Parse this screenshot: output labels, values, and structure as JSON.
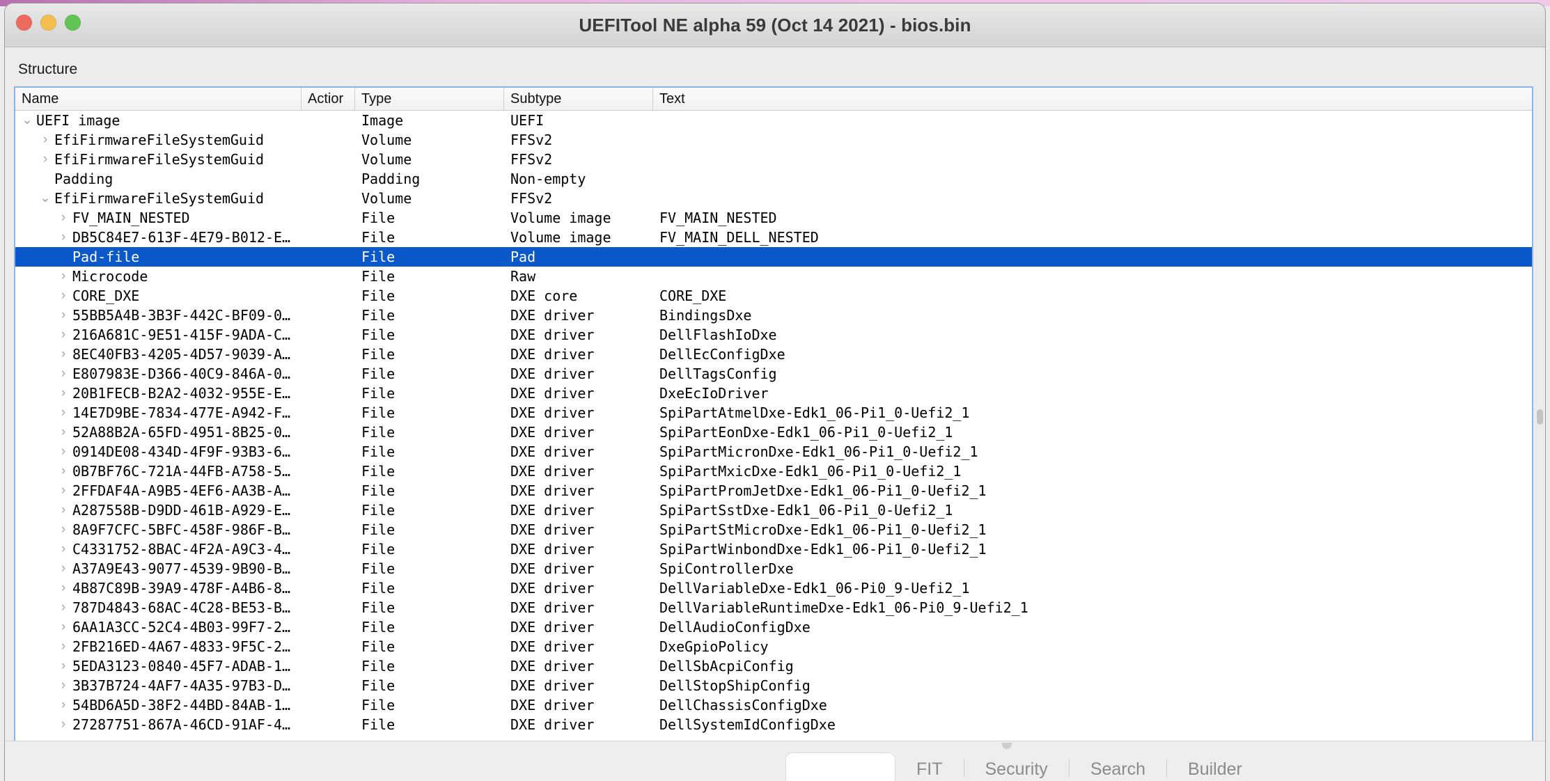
{
  "window": {
    "title": "UEFITool NE alpha 59 (Oct 14 2021) - bios.bin",
    "traffic_lights": {
      "close": "close-button",
      "minimize": "minimize-button",
      "zoom": "zoom-button"
    },
    "colors": {
      "selection_blue": "#0a58ca",
      "focus_border": "#8cb4e8",
      "close_red": "#ec6a5e",
      "minimize_yellow": "#f4bd4f",
      "zoom_green": "#61c454"
    }
  },
  "panel": {
    "label": "Structure"
  },
  "tree": {
    "columns": [
      "Name",
      "Actior",
      "Type",
      "Subtype",
      "Text"
    ],
    "selected_index": 7,
    "rows": [
      {
        "indent": 0,
        "twisty": "⌄",
        "name": "UEFI image",
        "action": "",
        "type": "Image",
        "subtype": "UEFI",
        "text": ""
      },
      {
        "indent": 1,
        "twisty": "›",
        "name": "EfiFirmwareFileSystemGuid",
        "action": "",
        "type": "Volume",
        "subtype": "FFSv2",
        "text": ""
      },
      {
        "indent": 1,
        "twisty": "›",
        "name": "EfiFirmwareFileSystemGuid",
        "action": "",
        "type": "Volume",
        "subtype": "FFSv2",
        "text": ""
      },
      {
        "indent": 1,
        "twisty": "",
        "name": "Padding",
        "action": "",
        "type": "Padding",
        "subtype": "Non-empty",
        "text": ""
      },
      {
        "indent": 1,
        "twisty": "⌄",
        "name": "EfiFirmwareFileSystemGuid",
        "action": "",
        "type": "Volume",
        "subtype": "FFSv2",
        "text": ""
      },
      {
        "indent": 2,
        "twisty": "›",
        "name": "FV_MAIN_NESTED",
        "action": "",
        "type": "File",
        "subtype": "Volume image",
        "text": "FV_MAIN_NESTED"
      },
      {
        "indent": 2,
        "twisty": "›",
        "name": "DB5C84E7-613F-4E79-B012-E…",
        "action": "",
        "type": "File",
        "subtype": "Volume image",
        "text": "FV_MAIN_DELL_NESTED"
      },
      {
        "indent": 2,
        "twisty": "",
        "name": "Pad-file",
        "action": "",
        "type": "File",
        "subtype": "Pad",
        "text": ""
      },
      {
        "indent": 2,
        "twisty": "›",
        "name": "Microcode",
        "action": "",
        "type": "File",
        "subtype": "Raw",
        "text": ""
      },
      {
        "indent": 2,
        "twisty": "›",
        "name": "CORE_DXE",
        "action": "",
        "type": "File",
        "subtype": "DXE core",
        "text": "CORE_DXE"
      },
      {
        "indent": 2,
        "twisty": "›",
        "name": "55BB5A4B-3B3F-442C-BF09-0…",
        "action": "",
        "type": "File",
        "subtype": "DXE driver",
        "text": "BindingsDxe"
      },
      {
        "indent": 2,
        "twisty": "›",
        "name": "216A681C-9E51-415F-9ADA-C…",
        "action": "",
        "type": "File",
        "subtype": "DXE driver",
        "text": "DellFlashIoDxe"
      },
      {
        "indent": 2,
        "twisty": "›",
        "name": "8EC40FB3-4205-4D57-9039-A…",
        "action": "",
        "type": "File",
        "subtype": "DXE driver",
        "text": "DellEcConfigDxe"
      },
      {
        "indent": 2,
        "twisty": "›",
        "name": "E807983E-D366-40C9-846A-0…",
        "action": "",
        "type": "File",
        "subtype": "DXE driver",
        "text": "DellTagsConfig"
      },
      {
        "indent": 2,
        "twisty": "›",
        "name": "20B1FECB-B2A2-4032-955E-E…",
        "action": "",
        "type": "File",
        "subtype": "DXE driver",
        "text": "DxeEcIoDriver"
      },
      {
        "indent": 2,
        "twisty": "›",
        "name": "14E7D9BE-7834-477E-A942-F…",
        "action": "",
        "type": "File",
        "subtype": "DXE driver",
        "text": "SpiPartAtmelDxe-Edk1_06-Pi1_0-Uefi2_1"
      },
      {
        "indent": 2,
        "twisty": "›",
        "name": "52A88B2A-65FD-4951-8B25-0…",
        "action": "",
        "type": "File",
        "subtype": "DXE driver",
        "text": "SpiPartEonDxe-Edk1_06-Pi1_0-Uefi2_1"
      },
      {
        "indent": 2,
        "twisty": "›",
        "name": "0914DE08-434D-4F9F-93B3-6…",
        "action": "",
        "type": "File",
        "subtype": "DXE driver",
        "text": "SpiPartMicronDxe-Edk1_06-Pi1_0-Uefi2_1"
      },
      {
        "indent": 2,
        "twisty": "›",
        "name": "0B7BF76C-721A-44FB-A758-5…",
        "action": "",
        "type": "File",
        "subtype": "DXE driver",
        "text": "SpiPartMxicDxe-Edk1_06-Pi1_0-Uefi2_1"
      },
      {
        "indent": 2,
        "twisty": "›",
        "name": "2FFDAF4A-A9B5-4EF6-AA3B-A…",
        "action": "",
        "type": "File",
        "subtype": "DXE driver",
        "text": "SpiPartPromJetDxe-Edk1_06-Pi1_0-Uefi2_1"
      },
      {
        "indent": 2,
        "twisty": "›",
        "name": "A287558B-D9DD-461B-A929-E…",
        "action": "",
        "type": "File",
        "subtype": "DXE driver",
        "text": "SpiPartSstDxe-Edk1_06-Pi1_0-Uefi2_1"
      },
      {
        "indent": 2,
        "twisty": "›",
        "name": "8A9F7CFC-5BFC-458F-986F-B…",
        "action": "",
        "type": "File",
        "subtype": "DXE driver",
        "text": "SpiPartStMicroDxe-Edk1_06-Pi1_0-Uefi2_1"
      },
      {
        "indent": 2,
        "twisty": "›",
        "name": "C4331752-8BAC-4F2A-A9C3-4…",
        "action": "",
        "type": "File",
        "subtype": "DXE driver",
        "text": "SpiPartWinbondDxe-Edk1_06-Pi1_0-Uefi2_1"
      },
      {
        "indent": 2,
        "twisty": "›",
        "name": "A37A9E43-9077-4539-9B90-B…",
        "action": "",
        "type": "File",
        "subtype": "DXE driver",
        "text": "SpiControllerDxe"
      },
      {
        "indent": 2,
        "twisty": "›",
        "name": "4B87C89B-39A9-478F-A4B6-8…",
        "action": "",
        "type": "File",
        "subtype": "DXE driver",
        "text": "DellVariableDxe-Edk1_06-Pi0_9-Uefi2_1"
      },
      {
        "indent": 2,
        "twisty": "›",
        "name": "787D4843-68AC-4C28-BE53-B…",
        "action": "",
        "type": "File",
        "subtype": "DXE driver",
        "text": "DellVariableRuntimeDxe-Edk1_06-Pi0_9-Uefi2_1"
      },
      {
        "indent": 2,
        "twisty": "›",
        "name": "6AA1A3CC-52C4-4B03-99F7-2…",
        "action": "",
        "type": "File",
        "subtype": "DXE driver",
        "text": "DellAudioConfigDxe"
      },
      {
        "indent": 2,
        "twisty": "›",
        "name": "2FB216ED-4A67-4833-9F5C-2…",
        "action": "",
        "type": "File",
        "subtype": "DXE driver",
        "text": "DxeGpioPolicy"
      },
      {
        "indent": 2,
        "twisty": "›",
        "name": "5EDA3123-0840-45F7-ADAB-1…",
        "action": "",
        "type": "File",
        "subtype": "DXE driver",
        "text": "DellSbAcpiConfig"
      },
      {
        "indent": 2,
        "twisty": "›",
        "name": "3B37B724-4AF7-4A35-97B3-D…",
        "action": "",
        "type": "File",
        "subtype": "DXE driver",
        "text": "DellStopShipConfig"
      },
      {
        "indent": 2,
        "twisty": "›",
        "name": "54BD6A5D-38F2-44BD-84AB-1…",
        "action": "",
        "type": "File",
        "subtype": "DXE driver",
        "text": "DellChassisConfigDxe"
      },
      {
        "indent": 2,
        "twisty": "›",
        "name": "27287751-867A-46CD-91AF-4…",
        "action": "",
        "type": "File",
        "subtype": "DXE driver",
        "text": "DellSystemIdConfigDxe"
      }
    ]
  },
  "tabbar": {
    "tabs": [
      {
        "label": "",
        "active": true
      },
      {
        "label": "FIT",
        "active": false
      },
      {
        "label": "Security",
        "active": false
      },
      {
        "label": "Search",
        "active": false
      },
      {
        "label": "Builder",
        "active": false
      }
    ]
  }
}
